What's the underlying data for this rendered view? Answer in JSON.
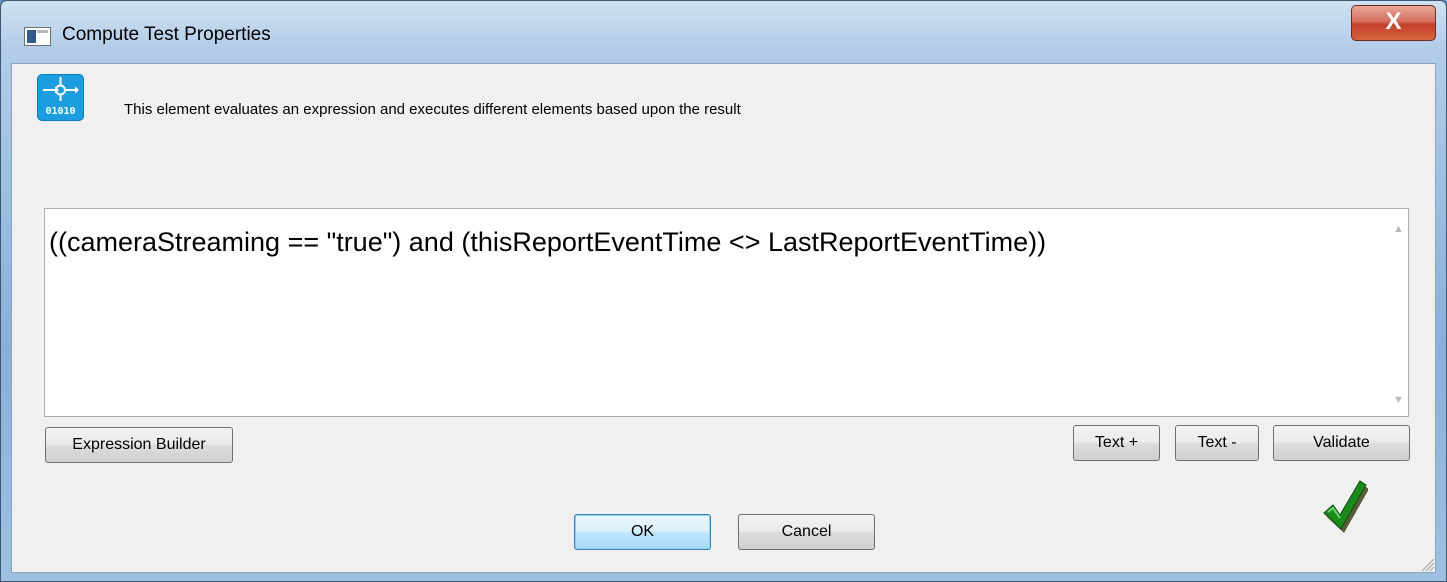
{
  "window": {
    "title": "Compute Test Properties",
    "close_glyph": "X",
    "app_icon": "window-app-icon"
  },
  "header": {
    "icon": "decision-flow-icon",
    "icon_text": "01010",
    "description": "This element evaluates an expression and executes different elements based upon the result"
  },
  "expression": {
    "value": "((cameraStreaming == \"true\") and (thisReportEventTime <> LastReportEventTime))"
  },
  "buttons": {
    "expression_builder": "Expression Builder",
    "text_plus": "Text +",
    "text_minus": "Text -",
    "validate": "Validate",
    "ok": "OK",
    "cancel": "Cancel"
  },
  "status": {
    "icon": "checkmark-icon",
    "color": "#1a8a1a"
  }
}
